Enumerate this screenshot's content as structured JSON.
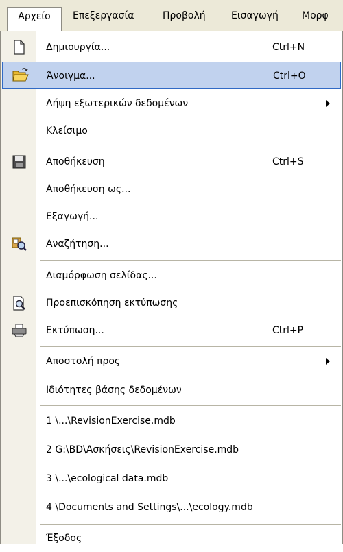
{
  "menubar": {
    "items": [
      {
        "label": "Αρχείο",
        "open": true
      },
      {
        "label": "Επεξεργασία"
      },
      {
        "label": "Προβολή"
      },
      {
        "label": "Εισαγωγή"
      },
      {
        "label": "Μορφ"
      }
    ]
  },
  "menu": {
    "items": [
      {
        "label": "Δημιουργία...",
        "shortcut": "Ctrl+N",
        "icon": "new-file-icon"
      },
      {
        "label": "Άνοιγμα...",
        "shortcut": "Ctrl+O",
        "icon": "open-folder-icon",
        "highlighted": true
      },
      {
        "label": "Λήψη εξωτερικών δεδομένων",
        "submenu": true
      },
      {
        "label": "Κλείσιμο"
      },
      {
        "label": "Αποθήκευση",
        "shortcut": "Ctrl+S",
        "icon": "save-icon"
      },
      {
        "label": "Αποθήκευση ως..."
      },
      {
        "label": "Εξαγωγή..."
      },
      {
        "label": "Αναζήτηση...",
        "icon": "search-icon"
      },
      {
        "label": "Διαμόρφωση σελίδας..."
      },
      {
        "label": "Προεπισκόπηση εκτύπωσης",
        "icon": "print-preview-icon"
      },
      {
        "label": "Εκτύπωση...",
        "shortcut": "Ctrl+P",
        "icon": "printer-icon"
      },
      {
        "label": "Αποστολή προς",
        "submenu": true
      },
      {
        "label": "Ιδιότητες βάσης δεδομένων"
      },
      {
        "label": "1 \\...\\RevisionExercise.mdb"
      },
      {
        "label": "2 G:\\BD\\Ασκήσεις\\RevisionExercise.mdb"
      },
      {
        "label": "3 \\...\\ecological data.mdb"
      },
      {
        "label": "4 \\Documents and Settings\\...\\ecology.mdb"
      },
      {
        "label": "Έξοδος"
      }
    ]
  },
  "colors": {
    "menubar_bg": "#ece9d8",
    "gutter_bg": "#f3f1e8",
    "highlight_bg": "#c1d2ee",
    "highlight_border": "#316ac5"
  }
}
